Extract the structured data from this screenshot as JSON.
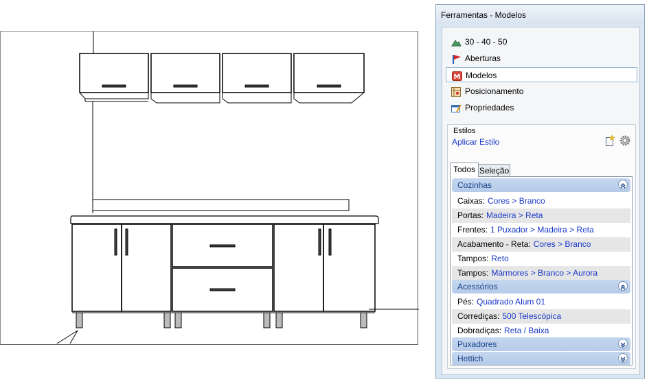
{
  "panel": {
    "title": "Ferramentas - Modelos",
    "nav": [
      {
        "label": "30 - 40 - 50",
        "icon": "terrain-icon"
      },
      {
        "label": "Aberturas",
        "icon": "flag-icon"
      },
      {
        "label": "Modelos",
        "icon": "model-icon",
        "active": true
      },
      {
        "label": "Posicionamento",
        "icon": "positioning-icon"
      },
      {
        "label": "Propriedades",
        "icon": "properties-icon"
      }
    ],
    "styles": {
      "legend": "Estilos",
      "apply_label": "Aplicar Estilo",
      "tabs": [
        "Todos",
        "Seleção"
      ]
    },
    "groups": {
      "cozinhas": {
        "title": "Cozinhas",
        "rows": [
          {
            "key": "Caixas:",
            "value": "Cores > Branco"
          },
          {
            "key": "Portas:",
            "value": "Madeira > Reta"
          },
          {
            "key": "Frentes:",
            "value": "1 Puxador > Madeira > Reta"
          },
          {
            "key": "Acabamento - Reta:",
            "value": "Cores > Branco"
          },
          {
            "key": "Tampos:",
            "value": "Reto"
          },
          {
            "key": "Tampos:",
            "value": "Mármores > Branco > Aurora"
          }
        ]
      },
      "acessorios": {
        "title": "Acessórios",
        "rows": [
          {
            "key": "Pés:",
            "value": "Quadrado Alum 01"
          },
          {
            "key": "Corrediças:",
            "value": "500 Telescópica"
          },
          {
            "key": "Dobradiças:",
            "value": "Reta / Baixa"
          }
        ]
      },
      "puxadores": {
        "title": "Puxadores"
      },
      "hettich": {
        "title": "Hettich"
      }
    }
  },
  "colors": {
    "link": "#1a39c8",
    "group_header": "#15428b",
    "group_bg": "#c5d7ef"
  }
}
